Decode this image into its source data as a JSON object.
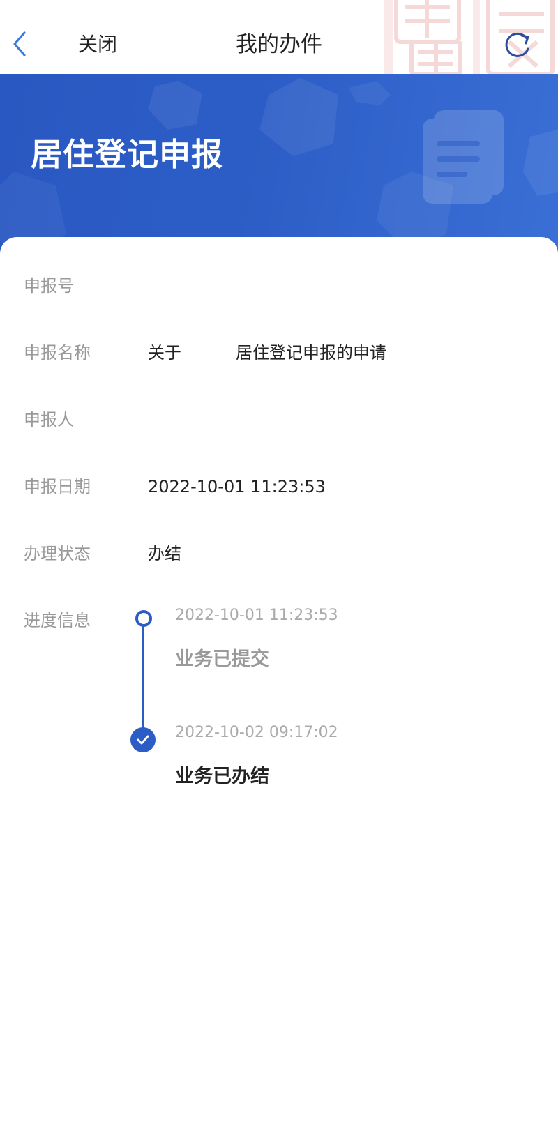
{
  "navbar": {
    "close_label": "关闭",
    "title": "我的办件",
    "back_icon": "chevron-left-icon",
    "refresh_icon": "refresh-icon",
    "accent_color": "#3a7be0"
  },
  "banner": {
    "title": "居住登记申报",
    "background_color": "#2c5dc6",
    "decor_icon": "document-icon"
  },
  "details": [
    {
      "label": "申报号",
      "value": ""
    },
    {
      "label": "申报名称",
      "value_prefix": "关于",
      "value_suffix": "居住登记申报的申请"
    },
    {
      "label": "申报人",
      "value": ""
    },
    {
      "label": "申报日期",
      "value": "2022-10-01 11:23:53"
    },
    {
      "label": "办理状态",
      "value": "办结"
    }
  ],
  "progress": {
    "label": "进度信息",
    "steps": [
      {
        "time": "2022-10-01 11:23:53",
        "status": "业务已提交",
        "icon": "circle-outline-icon"
      },
      {
        "time": "2022-10-02 09:17:02",
        "status": "业务已办结",
        "icon": "check-circle-icon"
      }
    ],
    "line_color": "#2c5dc6"
  }
}
